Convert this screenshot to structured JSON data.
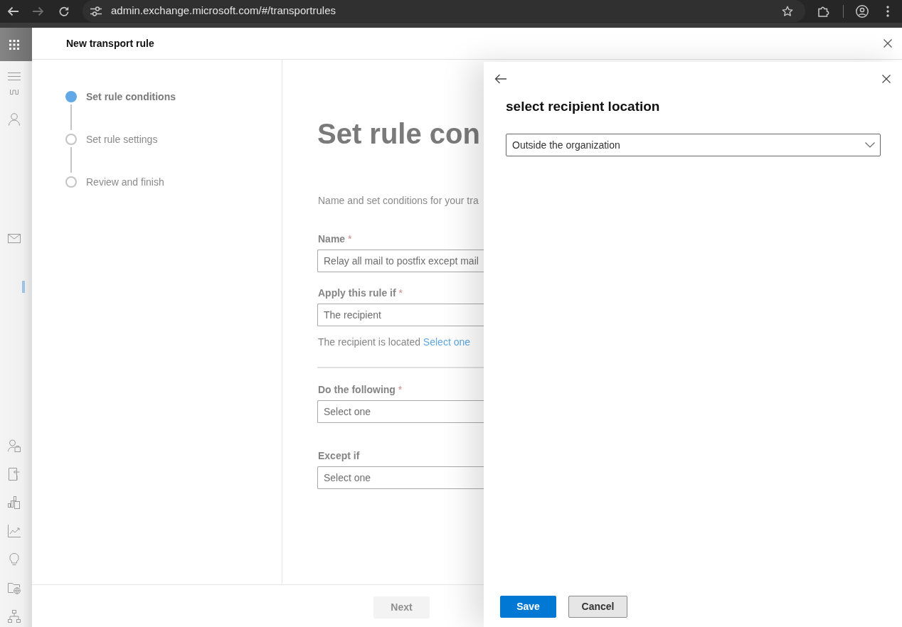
{
  "browser": {
    "url": "admin.exchange.microsoft.com/#/transportrules"
  },
  "dialog": {
    "title": "New transport rule"
  },
  "steps": [
    {
      "label": "Set rule conditions",
      "selected": true
    },
    {
      "label": "Set rule settings",
      "selected": false
    },
    {
      "label": "Review and finish",
      "selected": false
    }
  ],
  "form": {
    "heading": "Set rule con",
    "description": "Name and set conditions for your tra",
    "fields": [
      {
        "label": "Name",
        "required_mark": "*",
        "value": "Relay all mail to postfix except mail"
      },
      {
        "label": "Apply this rule if",
        "required_mark": "*",
        "value": "The recipient",
        "condition": {
          "text": "The recipient is located",
          "link": "Select one"
        }
      },
      {
        "label": "Do the following",
        "required_mark": "*",
        "value": "Select one"
      },
      {
        "label": "Except if",
        "value": "Select one"
      }
    ]
  },
  "footer": {
    "next": {
      "label": "Next",
      "disabled": true
    }
  },
  "panel": {
    "title": "select recipient location",
    "location": {
      "value": "Outside the organization"
    },
    "buttons": [
      {
        "label": "Save",
        "kind": "primary"
      },
      {
        "label": "Cancel",
        "kind": "secondary"
      }
    ]
  }
}
